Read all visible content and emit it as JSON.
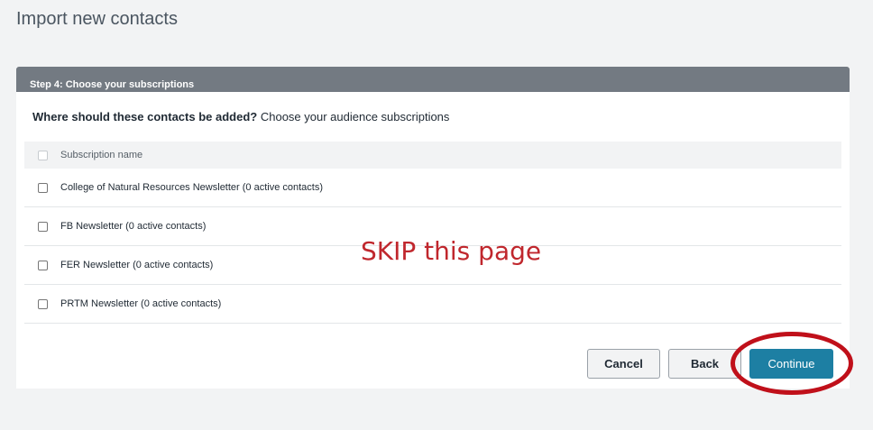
{
  "page": {
    "title": "Import new contacts"
  },
  "step": {
    "header": "Step 4: Choose your subscriptions"
  },
  "prompt": {
    "question": "Where should these contacts be added?",
    "instruction": "Choose your audience subscriptions"
  },
  "table": {
    "column_header": "Subscription name",
    "rows": [
      {
        "label": "College of Natural Resources Newsletter (0 active contacts)",
        "checked": false
      },
      {
        "label": "FB Newsletter (0 active contacts)",
        "checked": false
      },
      {
        "label": "FER Newsletter (0 active contacts)",
        "checked": false
      },
      {
        "label": "PRTM Newsletter (0 active contacts)",
        "checked": false
      }
    ]
  },
  "annotation": {
    "text": "SKIP this page",
    "color": "#c0272d"
  },
  "buttons": {
    "cancel": "Cancel",
    "back": "Back",
    "continue": "Continue"
  },
  "colors": {
    "header_bg": "#737a82",
    "primary": "#1d7fa3",
    "highlight_circle": "#c0101a"
  }
}
